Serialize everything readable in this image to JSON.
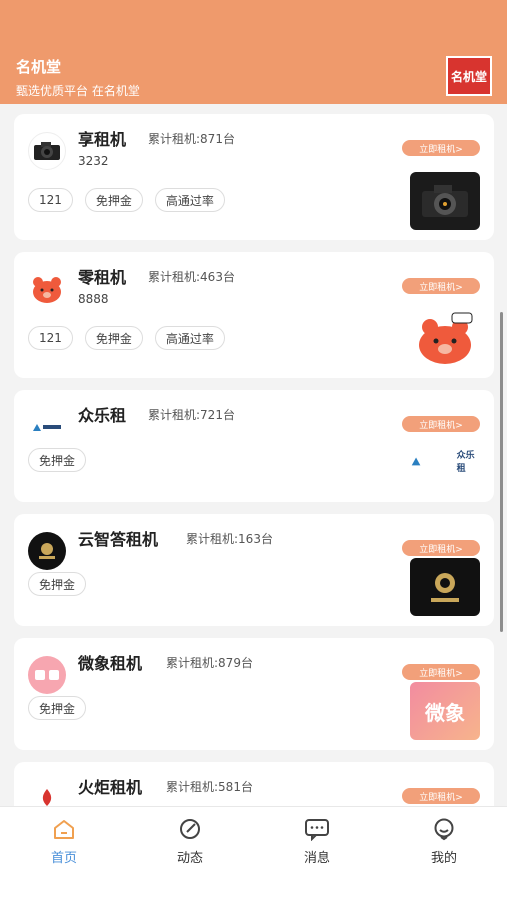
{
  "header": {
    "title": "名机堂",
    "subtitle": "甄选优质平台 在名机堂",
    "logo_text": "名机堂"
  },
  "cards": [
    {
      "name": "享租机",
      "count": "累计租机:871台",
      "code": "3232",
      "button": "立即租机>",
      "tags": [
        "121",
        "免押金",
        "高通过率"
      ],
      "thumb": "camera-image"
    },
    {
      "name": "零租机",
      "count": "累计租机:463台",
      "code": "8888",
      "button": "立即租机>",
      "tags": [
        "121",
        "免押金",
        "高通过率"
      ],
      "thumb": "bear-mascot-image"
    },
    {
      "name": "众乐租",
      "count": "累计租机:721台",
      "code": "",
      "button": "立即租机>",
      "tags": [
        "免押金"
      ],
      "thumb": "zhonglezu-logo",
      "thumb_text": "众乐租"
    },
    {
      "name": "云智答租机",
      "count": "累计租机:163台",
      "code": "",
      "button": "立即租机>",
      "tags": [
        "免押金"
      ],
      "thumb": "yunzhida-logo"
    },
    {
      "name": "微象租机",
      "count": "累计租机:879台",
      "code": "",
      "button": "立即租机>",
      "tags": [
        "免押金"
      ],
      "thumb": "weixiang-logo",
      "thumb_text": "微象"
    },
    {
      "name": "火炬租机",
      "count": "累计租机:581台",
      "code": "",
      "button": "立即租机>",
      "tags": [],
      "thumb": ""
    }
  ],
  "tabbar": {
    "items": [
      {
        "label": "首页",
        "icon": "home-icon",
        "active": true
      },
      {
        "label": "动态",
        "icon": "compass-icon",
        "active": false
      },
      {
        "label": "消息",
        "icon": "message-icon",
        "active": false
      },
      {
        "label": "我的",
        "icon": "profile-icon",
        "active": false
      }
    ]
  },
  "colors": {
    "header": "#ef9a6c",
    "button": "#f2a07a",
    "active_tab": "#4a90d9"
  }
}
